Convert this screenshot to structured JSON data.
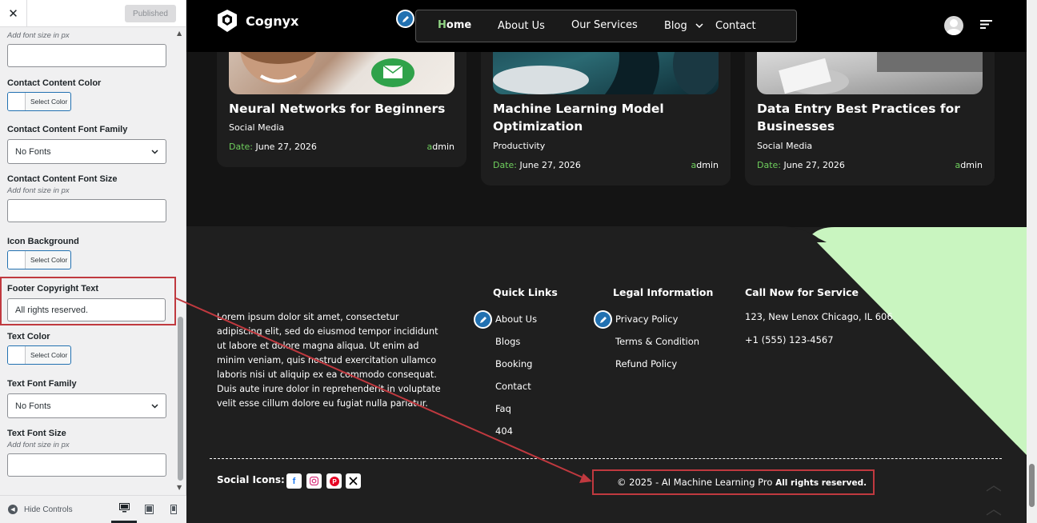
{
  "customizer": {
    "close_label": "✕",
    "publish_label": "Published",
    "controls": {
      "contact_font_size_desc": "Add font size in px",
      "contact_content_color_title": "Contact Content Color",
      "contact_content_font_family_title": "Contact Content Font Family",
      "contact_content_font_family_value": "No Fonts",
      "contact_content_font_size_title": "Contact Content Font Size",
      "contact_content_font_size_desc": "Add font size in px",
      "icon_background_title": "Icon Background",
      "footer_copyright_title": "Footer Copyright Text",
      "footer_copyright_value": "All rights reserved.",
      "text_color_title": "Text Color",
      "text_font_family_title": "Text Font Family",
      "text_font_family_value": "No Fonts",
      "text_font_size_title": "Text Font Size",
      "text_font_size_desc": "Add font size in px",
      "select_color_label": "Select Color"
    },
    "footer": {
      "hide_controls_label": "Hide Controls"
    }
  },
  "site": {
    "logo_text": "Cognyx",
    "nav": {
      "home_first": "H",
      "home_rest": "ome",
      "about": "About Us",
      "services": "Our Services",
      "blog": "Blog",
      "contact": "Contact"
    },
    "posts": [
      {
        "title": "Neural Networks for Beginners",
        "category": "Social Media",
        "date_label": "Date:",
        "date": " June 27, 2026",
        "author_first": "a",
        "author_rest": "dmin"
      },
      {
        "title": "Machine Learning Model Optimization",
        "category": "Productivity",
        "date_label": "Date:",
        "date": " June 27, 2026",
        "author_first": "a",
        "author_rest": "dmin"
      },
      {
        "title": "Data Entry Best Practices for Businesses",
        "category": "Social Media",
        "date_label": "Date:",
        "date": " June 27, 2026",
        "author_first": "a",
        "author_rest": "dmin"
      }
    ],
    "footer": {
      "about_text": "Lorem ipsum dolor sit amet, consectetur adipiscing elit, sed do eiusmod tempor incididunt ut labore et dolore magna aliqua. Ut enim ad minim veniam, quis nostrud exercitation ullamco laboris nisi ut aliquip ex ea commodo consequat. Duis aute irure dolor in reprehenderit in voluptate velit esse cillum dolore eu fugiat nulla pariatur.",
      "quick_links_title": "Quick Links",
      "quick_links": [
        "About Us",
        "Blogs",
        "Booking",
        "Contact",
        "Faq",
        "404"
      ],
      "legal_title": "Legal Information",
      "legal_links": [
        "Privacy Policy",
        "Terms & Condition",
        "Refund Policy"
      ],
      "call_title": "Call Now for Service",
      "address": "123, New Lenox Chicago, IL 60606",
      "phone": "+1 (555) 123-4567",
      "social_label": "Social Icons:",
      "copyright_main": "© 2025 - AI Machine Learning Pro",
      "copyright_suffix": " All rights reserved."
    }
  },
  "colors": {
    "accent_green": "#8fd282",
    "highlight_red": "#c0393f",
    "wp_blue": "#2271b1"
  }
}
